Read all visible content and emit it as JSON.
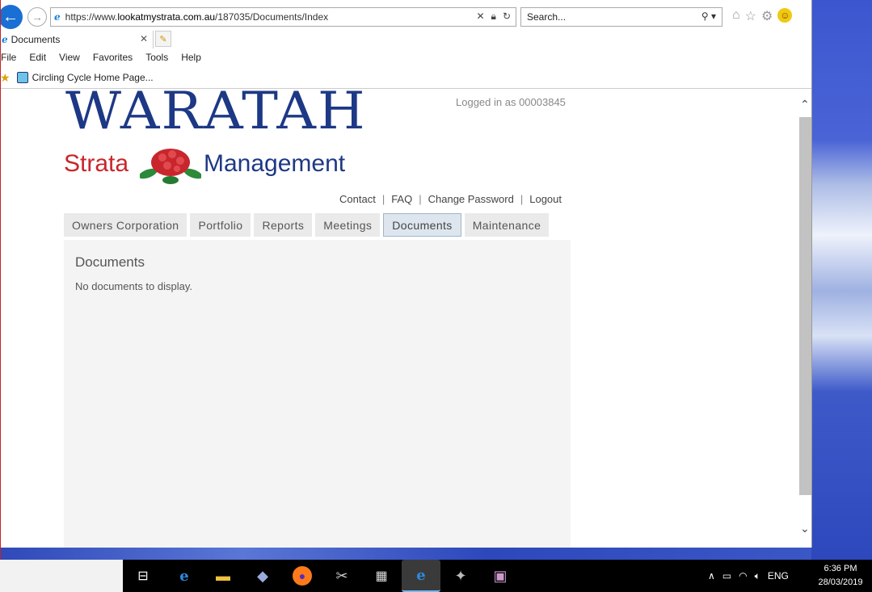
{
  "browser": {
    "url_prefix": "https://www.",
    "url_domain": "lookatmystrata.com.au",
    "url_path": "/187035/Documents/Index",
    "search_placeholder": "Search...",
    "tab_title": "Documents",
    "menu": [
      "File",
      "Edit",
      "View",
      "Favorites",
      "Tools",
      "Help"
    ],
    "favorites": [
      {
        "label": "Circling Cycle Home Page..."
      }
    ]
  },
  "site": {
    "logo_main": "WARATAH",
    "logo_sub_left": "Strata",
    "logo_sub_right": "Management",
    "login_status": "Logged in as 00003845",
    "user_links": [
      "Contact",
      "FAQ",
      "Change Password",
      "Logout"
    ],
    "nav_tabs": [
      "Owners Corporation",
      "Portfolio",
      "Reports",
      "Meetings",
      "Documents",
      "Maintenance"
    ],
    "active_tab": "Documents",
    "panel_title": "Documents",
    "panel_message": "No documents to display."
  },
  "taskbar": {
    "tray_lang": "ENG",
    "time": "6:36 PM",
    "date": "28/03/2019"
  },
  "icons": {
    "back": "back-arrow-icon",
    "forward": "forward-arrow-icon",
    "home": "home-icon",
    "favorites": "star-icon",
    "settings": "gear-icon",
    "feedback": "smiley-icon"
  },
  "colors": {
    "brand_blue": "#1d3885",
    "brand_red": "#c8262c",
    "active_tab_bg": "#dde6ee",
    "panel_bg": "#f3f4f3"
  }
}
